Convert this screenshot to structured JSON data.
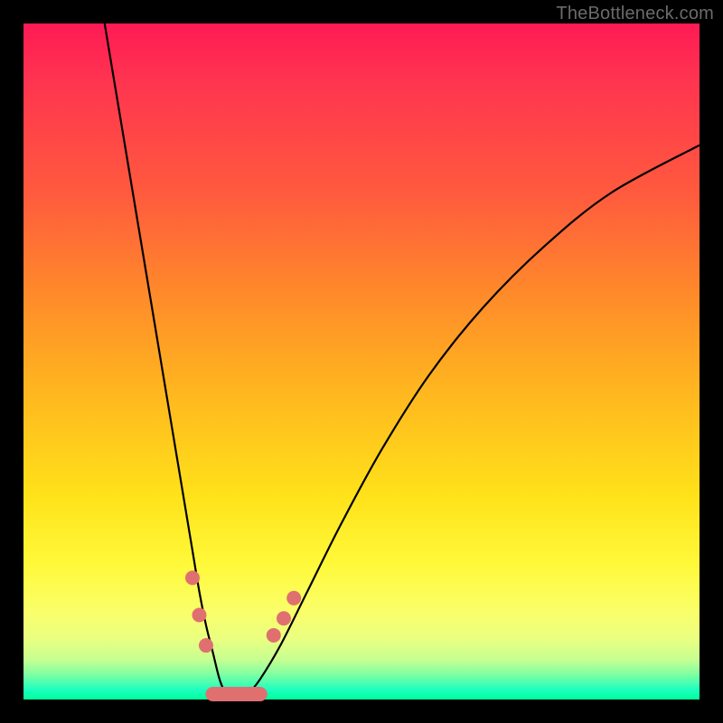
{
  "watermark": "TheBottleneck.com",
  "chart_data": {
    "type": "line",
    "title": "",
    "xlabel": "",
    "ylabel": "",
    "xlim": [
      0,
      100
    ],
    "ylim": [
      0,
      100
    ],
    "grid": false,
    "legend": false,
    "notes": "V-shaped bottleneck curve over a red→yellow→green vertical gradient. Two black curve branches descend from upper corners and meet near x≈30 at y≈0. Salmon-colored markers cluster around the minimum on both branches.",
    "series": [
      {
        "name": "left-branch",
        "x": [
          12,
          14,
          16,
          18,
          20,
          22,
          24,
          25,
          26,
          27,
          28,
          29,
          30
        ],
        "y": [
          100,
          88,
          76,
          64,
          52,
          40,
          28,
          22,
          16,
          11,
          7,
          3,
          0.5
        ]
      },
      {
        "name": "right-branch",
        "x": [
          33,
          35,
          38,
          42,
          47,
          53,
          60,
          68,
          77,
          87,
          100
        ],
        "y": [
          0.5,
          3,
          8,
          16,
          26,
          37,
          48,
          58,
          67,
          75,
          82
        ]
      }
    ],
    "markers": {
      "left_branch": [
        {
          "x": 25.0,
          "y": 18.0
        },
        {
          "x": 26.0,
          "y": 12.5
        },
        {
          "x": 27.0,
          "y": 8.0
        }
      ],
      "right_branch": [
        {
          "x": 37.0,
          "y": 9.5
        },
        {
          "x": 38.5,
          "y": 12.0
        },
        {
          "x": 40.0,
          "y": 15.0
        }
      ],
      "floor_blob": {
        "x_start": 28.0,
        "x_end": 35.0,
        "y": 0.8
      }
    },
    "gradient_stops": [
      {
        "pos": 0.0,
        "color": "#ff1a54"
      },
      {
        "pos": 0.4,
        "color": "#ff8a2a"
      },
      {
        "pos": 0.8,
        "color": "#fff93a"
      },
      {
        "pos": 0.97,
        "color": "#4cffb0"
      },
      {
        "pos": 1.0,
        "color": "#00ff9c"
      }
    ]
  }
}
